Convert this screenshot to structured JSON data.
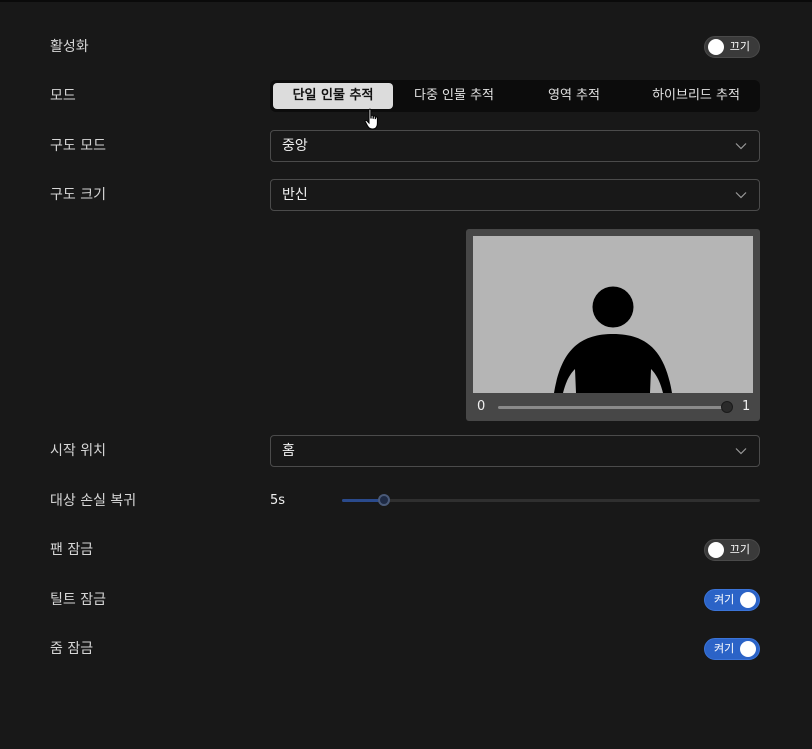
{
  "settings": {
    "enable": {
      "label": "활성화",
      "toggle_text": "끄기",
      "state": "off"
    },
    "mode": {
      "label": "모드",
      "options": [
        "단일 인물 추적",
        "다중 인물 추적",
        "영역 추적",
        "하이브리드 추적"
      ],
      "selected": "단일 인물 추적"
    },
    "composition_mode": {
      "label": "구도 모드",
      "value": "중앙"
    },
    "composition_size": {
      "label": "구도 크기",
      "value": "반신"
    },
    "preview": {
      "min_label": "0",
      "max_label": "1",
      "value": 1
    },
    "start_position": {
      "label": "시작 위치",
      "value": "홈"
    },
    "target_loss_recovery": {
      "label": "대상 손실 복귀",
      "value_text": "5s",
      "fraction": 0.1
    },
    "pan_lock": {
      "label": "팬 잠금",
      "toggle_text": "끄기",
      "state": "off"
    },
    "tilt_lock": {
      "label": "틸트 잠금",
      "toggle_text": "켜기",
      "state": "on"
    },
    "zoom_lock": {
      "label": "줌 잠금",
      "toggle_text": "켜기",
      "state": "on"
    }
  },
  "colors": {
    "background": "#181818",
    "toggle_on": "#2b63c7",
    "segment_active": "#dcdcdc",
    "preview_frame": "#b5b5b5"
  },
  "icons": [
    "chevron-down-icon",
    "person-silhouette-icon",
    "hand-pointer-icon"
  ]
}
